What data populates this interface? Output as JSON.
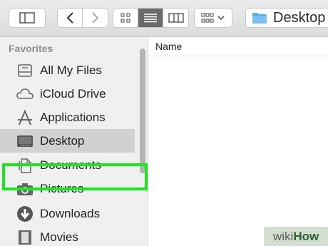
{
  "toolbar": {
    "path_label": "Desktop"
  },
  "sidebar": {
    "section_title": "Favorites",
    "items": [
      {
        "label": "All My Files",
        "icon": "all-files-icon"
      },
      {
        "label": "iCloud Drive",
        "icon": "cloud-icon"
      },
      {
        "label": "Applications",
        "icon": "applications-icon"
      },
      {
        "label": "Desktop",
        "icon": "desktop-icon",
        "selected": true
      },
      {
        "label": "Documents",
        "icon": "documents-icon"
      },
      {
        "label": "Pictures",
        "icon": "camera-icon"
      },
      {
        "label": "Downloads",
        "icon": "download-icon",
        "highlighted": true
      },
      {
        "label": "Movies",
        "icon": "film-icon"
      }
    ]
  },
  "main": {
    "column_header": "Name"
  },
  "watermark": {
    "part1": "wiki",
    "part2": "How"
  },
  "colors": {
    "highlight": "#1ee61e",
    "folder": "#5aa9e8"
  }
}
